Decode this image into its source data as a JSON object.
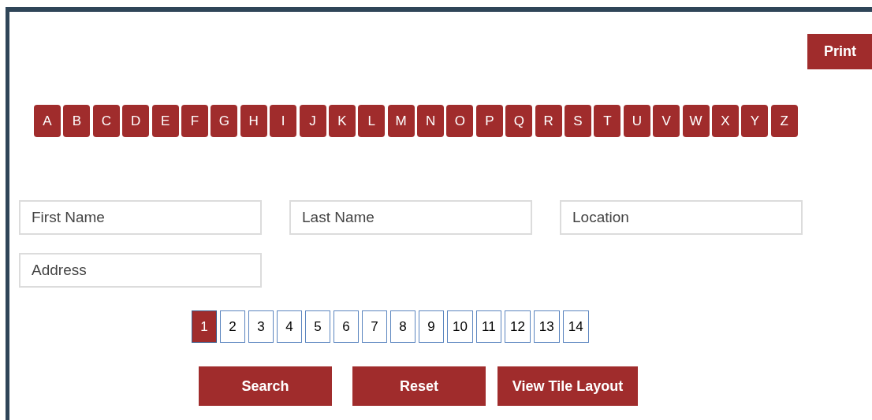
{
  "print_button": "Print",
  "alphabet": [
    "A",
    "B",
    "C",
    "D",
    "E",
    "F",
    "G",
    "H",
    "I",
    "J",
    "K",
    "L",
    "M",
    "N",
    "O",
    "P",
    "Q",
    "R",
    "S",
    "T",
    "U",
    "V",
    "W",
    "X",
    "Y",
    "Z"
  ],
  "fields": [
    {
      "placeholder": "First Name"
    },
    {
      "placeholder": "Last Name"
    },
    {
      "placeholder": "Location"
    },
    {
      "placeholder": "Address"
    }
  ],
  "pagination": [
    {
      "label": "1",
      "selected": true
    },
    {
      "label": "2",
      "selected": false
    },
    {
      "label": "3",
      "selected": false
    },
    {
      "label": "4",
      "selected": false
    },
    {
      "label": "5",
      "selected": false
    },
    {
      "label": "6",
      "selected": false
    },
    {
      "label": "7",
      "selected": false
    },
    {
      "label": "8",
      "selected": false
    },
    {
      "label": "9",
      "selected": false
    },
    {
      "label": "10",
      "selected": false
    },
    {
      "label": "11",
      "selected": false
    },
    {
      "label": "12",
      "selected": false
    },
    {
      "label": "13",
      "selected": false
    },
    {
      "label": "14",
      "selected": false
    }
  ],
  "buttons": [
    "Search",
    "Reset",
    "View Tile Layout"
  ]
}
